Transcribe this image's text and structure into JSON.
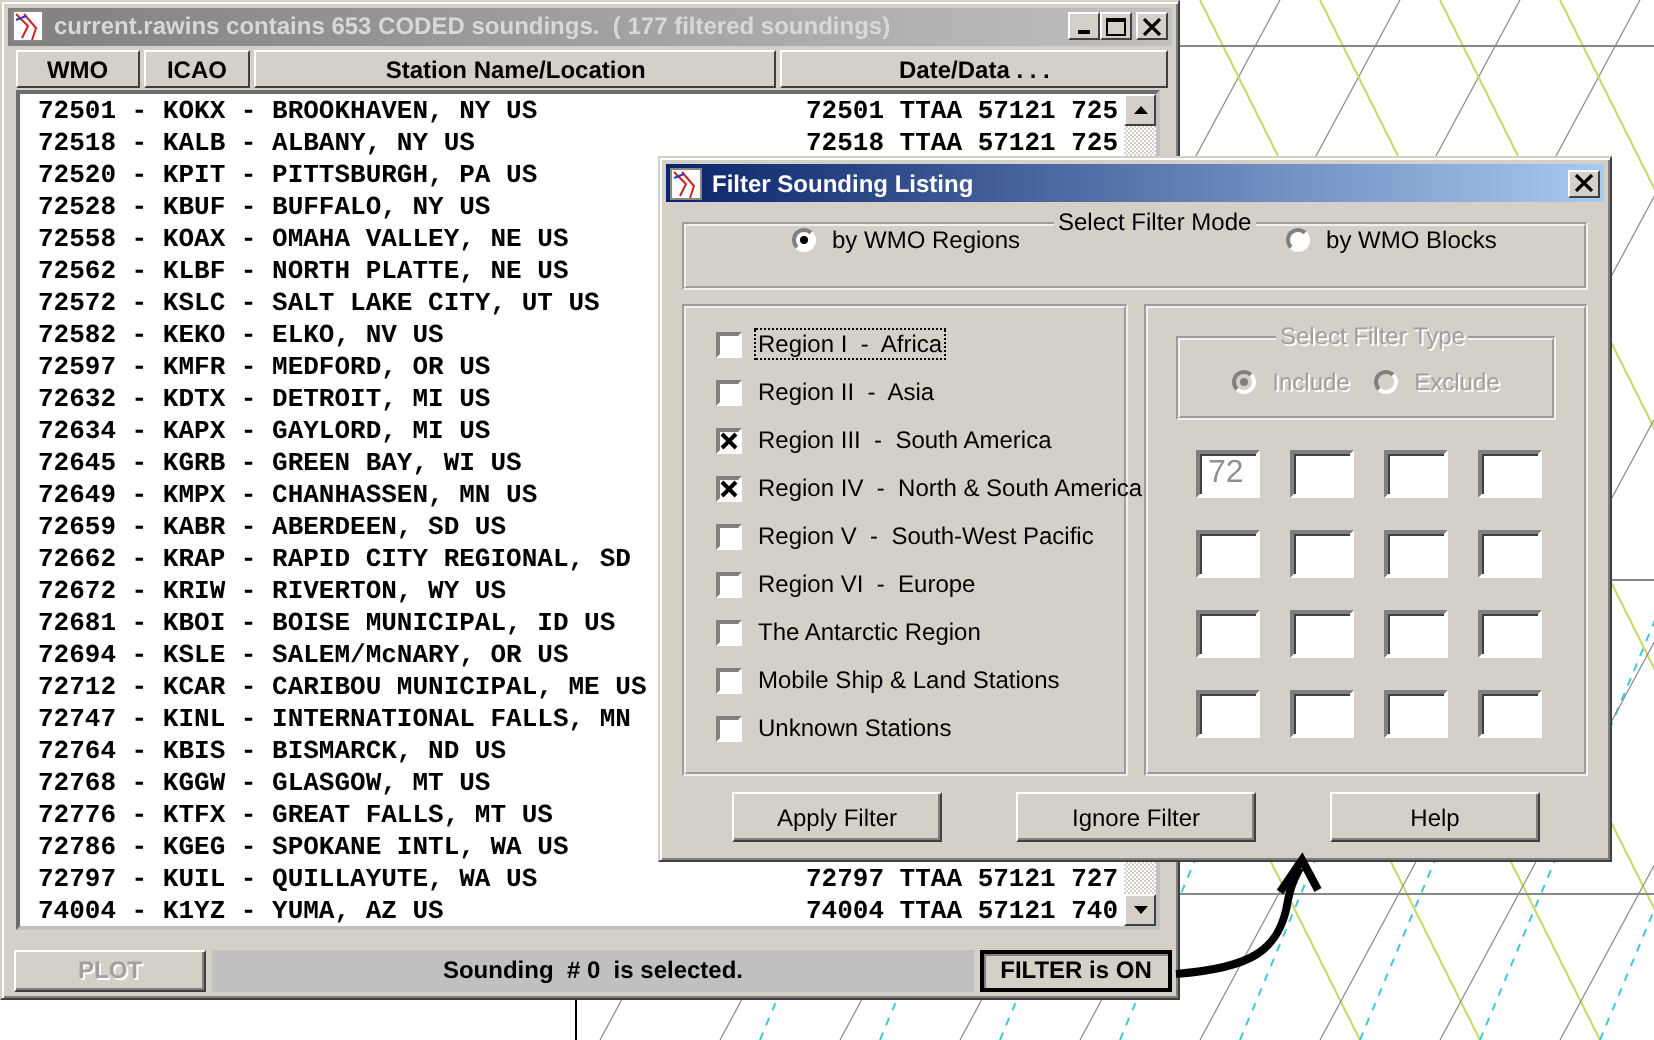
{
  "main_window": {
    "title": "current.rawins contains 653 CODED soundings.  ( 177 filtered soundings)",
    "active": false,
    "columns": [
      "WMO",
      "ICAO",
      "Station Name/Location",
      "Date/Data . . ."
    ],
    "rows": [
      {
        "station": "72501 - KOKX - BROOKHAVEN, NY US",
        "data": "72501 TTAA 57121 725"
      },
      {
        "station": "72518 - KALB - ALBANY, NY US",
        "data": "72518 TTAA 57121 725"
      },
      {
        "station": "72520 - KPIT - PITTSBURGH, PA US"
      },
      {
        "station": "72528 - KBUF - BUFFALO, NY US"
      },
      {
        "station": "72558 - KOAX - OMAHA VALLEY, NE US"
      },
      {
        "station": "72562 - KLBF - NORTH PLATTE, NE US"
      },
      {
        "station": "72572 - KSLC - SALT LAKE CITY, UT US"
      },
      {
        "station": "72582 - KEKO - ELKO, NV US"
      },
      {
        "station": "72597 - KMFR - MEDFORD, OR US"
      },
      {
        "station": "72632 - KDTX - DETROIT, MI US"
      },
      {
        "station": "72634 - KAPX - GAYLORD, MI US"
      },
      {
        "station": "72645 - KGRB - GREEN BAY, WI US"
      },
      {
        "station": "72649 - KMPX - CHANHASSEN, MN US"
      },
      {
        "station": "72659 - KABR - ABERDEEN, SD US"
      },
      {
        "station": "72662 - KRAP - RAPID CITY REGIONAL, SD"
      },
      {
        "station": "72672 - KRIW - RIVERTON, WY US"
      },
      {
        "station": "72681 - KBOI - BOISE MUNICIPAL, ID US"
      },
      {
        "station": "72694 - KSLE - SALEM/McNARY, OR US"
      },
      {
        "station": "72712 - KCAR - CARIBOU MUNICIPAL, ME US"
      },
      {
        "station": "72747 - KINL - INTERNATIONAL FALLS, MN"
      },
      {
        "station": "72764 - KBIS - BISMARCK, ND US"
      },
      {
        "station": "72768 - KGGW - GLASGOW, MT US"
      },
      {
        "station": "72776 - KTFX - GREAT FALLS, MT US"
      },
      {
        "station": "72786 - KGEG - SPOKANE INTL, WA US"
      },
      {
        "station": "72797 - KUIL - QUILLAYUTE, WA US",
        "data": "72797 TTAA 57121 727"
      },
      {
        "station": "74004 - K1YZ - YUMA, AZ US",
        "data": "74004 TTAA 57121 740"
      }
    ],
    "status_bar": {
      "plot_button": {
        "label": "PLOT",
        "disabled": true
      },
      "message": "Sounding  # 0  is selected.",
      "filter_button": {
        "label": "FILTER is ON",
        "pressed": true
      }
    }
  },
  "dialog": {
    "title": "Filter Sounding Listing",
    "active": true,
    "filter_mode": {
      "label": "Select Filter Mode",
      "options": [
        {
          "label": "by WMO Regions",
          "selected": true
        },
        {
          "label": "by WMO Blocks",
          "selected": false
        }
      ]
    },
    "regions": [
      {
        "label": "Region I  -  Africa",
        "checked": false,
        "focused": true
      },
      {
        "label": "Region II  -  Asia",
        "checked": false,
        "focused": false
      },
      {
        "label": "Region III  -  South America",
        "checked": true,
        "focused": false
      },
      {
        "label": "Region IV  -  North & South America",
        "checked": true,
        "focused": false
      },
      {
        "label": "Region V  -  South-West Pacific",
        "checked": false,
        "focused": false
      },
      {
        "label": "Region VI  -  Europe",
        "checked": false,
        "focused": false
      },
      {
        "label": "The Antarctic Region",
        "checked": false,
        "focused": false
      },
      {
        "label": "Mobile Ship & Land Stations",
        "checked": false,
        "focused": false
      },
      {
        "label": "Unknown Stations",
        "checked": false,
        "focused": false
      }
    ],
    "filter_type": {
      "label": "Select Filter Type",
      "disabled": true,
      "options": [
        {
          "label": "Include",
          "selected": true
        },
        {
          "label": "Exclude",
          "selected": false
        }
      ]
    },
    "block_values": [
      "72"
    ],
    "buttons": [
      "Apply Filter",
      "Ignore Filter",
      "Help"
    ]
  }
}
